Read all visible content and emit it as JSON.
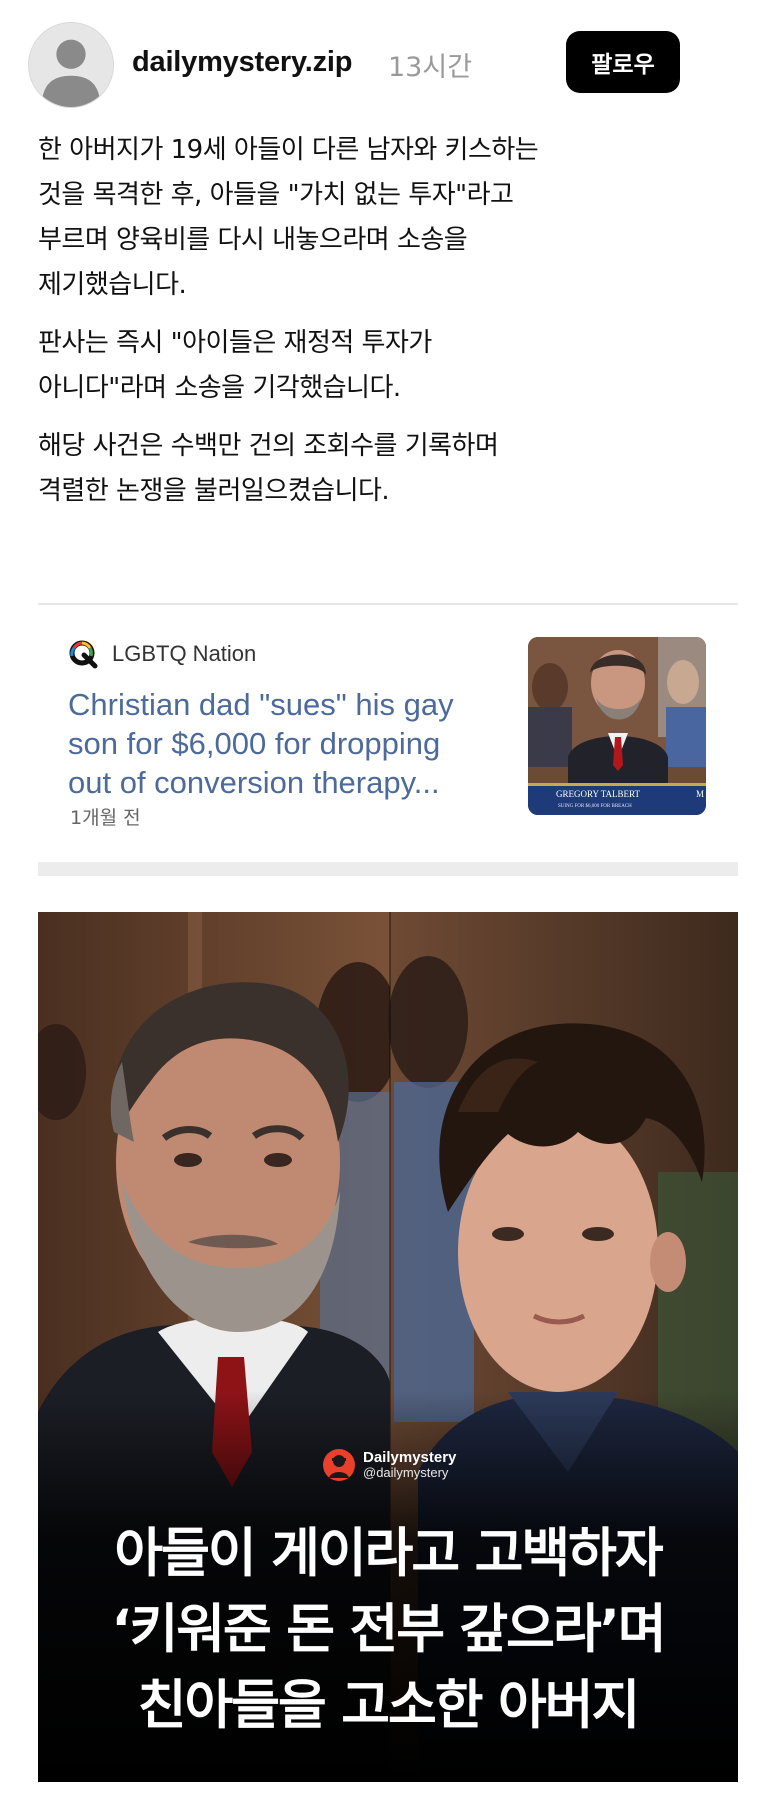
{
  "header": {
    "avatar_icon": "default-user-avatar-icon",
    "username": "dailymystery.zip",
    "timestamp": "13시간",
    "follow_label": "팔로우"
  },
  "post": {
    "paragraphs": [
      [
        "한 아버지가 19세 아들이 다른 남자와 키스하는",
        "것을 목격한 후, 아들을 \"가치 없는 투자\"라고",
        "부르며 양육비를 다시 내놓으라며 소송을",
        "제기했습니다."
      ],
      [
        "판사는 즉시 \"아이들은 재정적 투자가",
        "아니다\"라며 소송을 기각했습니다."
      ],
      [
        "해당 사건은 수백만 건의 조회수를 기록하며",
        "격렬한 논쟁을 불러일으켰습니다."
      ]
    ]
  },
  "link_card": {
    "source_icon": "lgbtq-nation-logo-icon",
    "source_name": "LGBTQ Nation",
    "title_lines": [
      "Christian dad \"sues\" his gay",
      "son for $6,000 for dropping",
      "out of conversion therapy..."
    ],
    "age": "1개월 전",
    "thumbnail_caption": "GREGORY TALBERT",
    "thumbnail_subcaption": "SUING FOR $6,000 FOR BREACH",
    "thumbnail_caption_cutoff": "M"
  },
  "image": {
    "watermark_name": "Dailymystery",
    "watermark_handle": "@dailymystery",
    "headline_lines": [
      "아들이 게이라고 고백하자",
      "‘키워준 돈 전부 갚으라’며",
      "친아들을 고소한 아버지"
    ]
  },
  "colors": {
    "follow_bg": "#000000",
    "link_title": "#4d6a9c",
    "timestamp": "#9a9a9a"
  }
}
